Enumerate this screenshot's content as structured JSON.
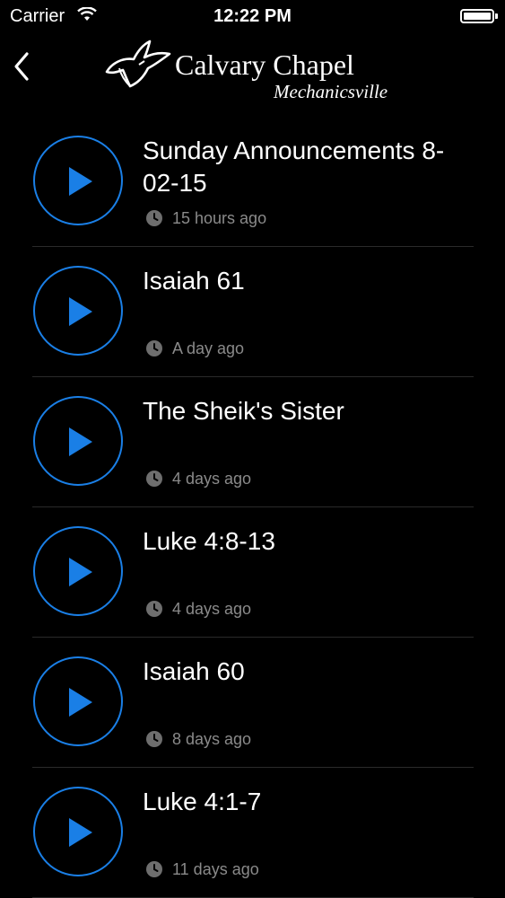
{
  "status_bar": {
    "carrier": "Carrier",
    "time": "12:22 PM",
    "battery_level": 1.0
  },
  "nav": {
    "logo_title": "Calvary Chapel",
    "logo_subtitle": "Mechanicsville",
    "back_icon": "chevron-left-icon"
  },
  "colors": {
    "accent": "#1a7fe6",
    "background": "#000000",
    "meta_text": "#8a8a8a"
  },
  "items": [
    {
      "title": "Sunday Announcements 8-02-15",
      "time_ago": "15 hours ago"
    },
    {
      "title": "Isaiah 61",
      "time_ago": "A day ago"
    },
    {
      "title": "The Sheik's Sister",
      "time_ago": "4 days ago"
    },
    {
      "title": "Luke 4:8-13",
      "time_ago": "4 days ago"
    },
    {
      "title": "Isaiah 60",
      "time_ago": "8 days ago"
    },
    {
      "title": "Luke 4:1-7",
      "time_ago": "11 days ago"
    }
  ]
}
